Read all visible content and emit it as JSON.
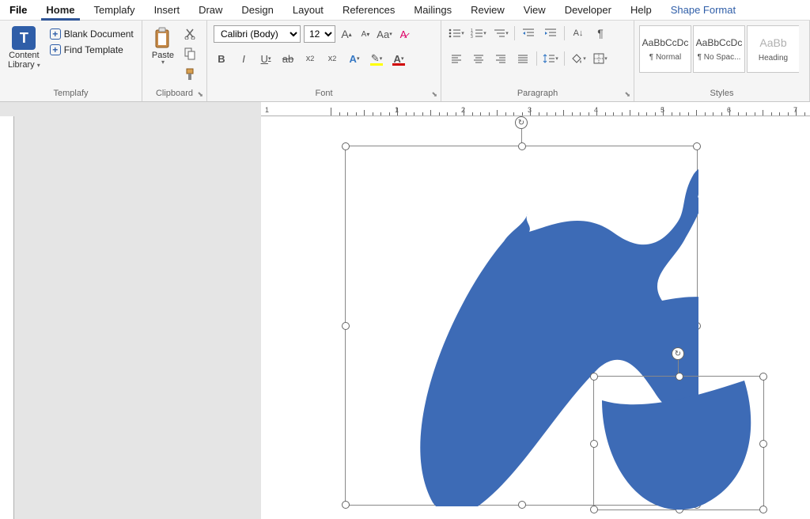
{
  "tabs": [
    "File",
    "Home",
    "Templafy",
    "Insert",
    "Draw",
    "Design",
    "Layout",
    "References",
    "Mailings",
    "Review",
    "View",
    "Developer",
    "Help",
    "Shape Format"
  ],
  "active_tab": "Home",
  "groups": {
    "templafy": {
      "label": "Templafy",
      "content_library": "Content\nLibrary",
      "blank_doc": "Blank Document",
      "find_template": "Find Template"
    },
    "clipboard": {
      "label": "Clipboard",
      "paste": "Paste"
    },
    "font": {
      "label": "Font",
      "name": "Calibri (Body)",
      "size": "12"
    },
    "paragraph": {
      "label": "Paragraph"
    },
    "styles": {
      "label": "Styles",
      "tiles": [
        {
          "preview": "AaBbCcDc",
          "name": "¶ Normal"
        },
        {
          "preview": "AaBbCcDc",
          "name": "¶ No Spac..."
        },
        {
          "preview": "AaBb",
          "name": "Heading"
        }
      ]
    }
  },
  "ruler_numbers": [
    "1",
    "2",
    "3",
    "4",
    "5",
    "6",
    "7"
  ],
  "shape_fill": "#3d6bb6"
}
